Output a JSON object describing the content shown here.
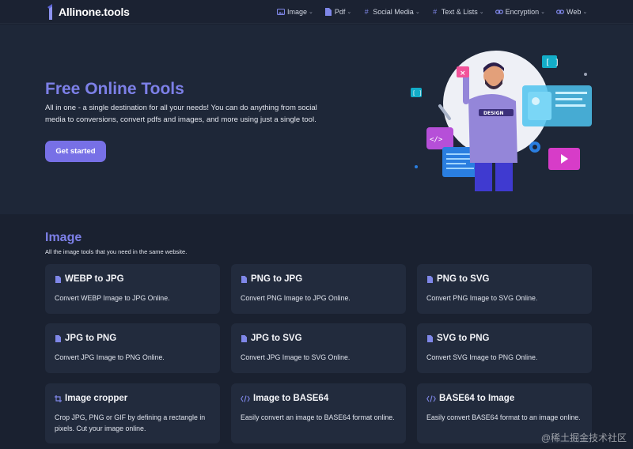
{
  "brand": {
    "name": "Allinone.tools"
  },
  "nav": [
    {
      "label": "Image",
      "icon": "image-icon"
    },
    {
      "label": "Pdf",
      "icon": "file-icon"
    },
    {
      "label": "Social Media",
      "icon": "hash-icon"
    },
    {
      "label": "Text & Lists",
      "icon": "hash-icon"
    },
    {
      "label": "Encryption",
      "icon": "link-icon"
    },
    {
      "label": "Web",
      "icon": "link-icon"
    }
  ],
  "hero": {
    "title": "Free Online Tools",
    "description": "All in one - a single destination for all your needs! You can do anything from social media to conversions, convert pdfs and images, and more using just a single tool.",
    "cta_label": "Get started",
    "illustration_badge": "DESIGN"
  },
  "section": {
    "title": "Image",
    "subtitle": "All the image tools that you need in the same website."
  },
  "cards": [
    {
      "title": "WEBP to JPG",
      "desc": "Convert WEBP Image to JPG Online.",
      "icon": "file-icon"
    },
    {
      "title": "PNG to JPG",
      "desc": "Convert PNG Image to JPG Online.",
      "icon": "file-icon"
    },
    {
      "title": "PNG to SVG",
      "desc": "Convert PNG Image to SVG Online.",
      "icon": "file-icon"
    },
    {
      "title": "JPG to PNG",
      "desc": "Convert JPG Image to PNG Online.",
      "icon": "file-icon"
    },
    {
      "title": "JPG to SVG",
      "desc": "Convert JPG Image to SVG Online.",
      "icon": "file-icon"
    },
    {
      "title": "SVG to PNG",
      "desc": "Convert SVG Image to PNG Online.",
      "icon": "file-icon"
    },
    {
      "title": "Image cropper",
      "desc": "Crop JPG, PNG or GIF by defining a rectangle in pixels. Cut your image online.",
      "icon": "crop-icon"
    },
    {
      "title": "Image to BASE64",
      "desc": "Easily convert an image to BASE64 format online.",
      "icon": "code-icon"
    },
    {
      "title": "BASE64 to Image",
      "desc": "Easily convert BASE64 format to an image online.",
      "icon": "code-icon"
    }
  ],
  "watermark": "@稀土掘金技术社区",
  "colors": {
    "accent": "#7d80e8",
    "button": "#7770e6",
    "background": "#1a2130",
    "card": "#222b3d"
  }
}
